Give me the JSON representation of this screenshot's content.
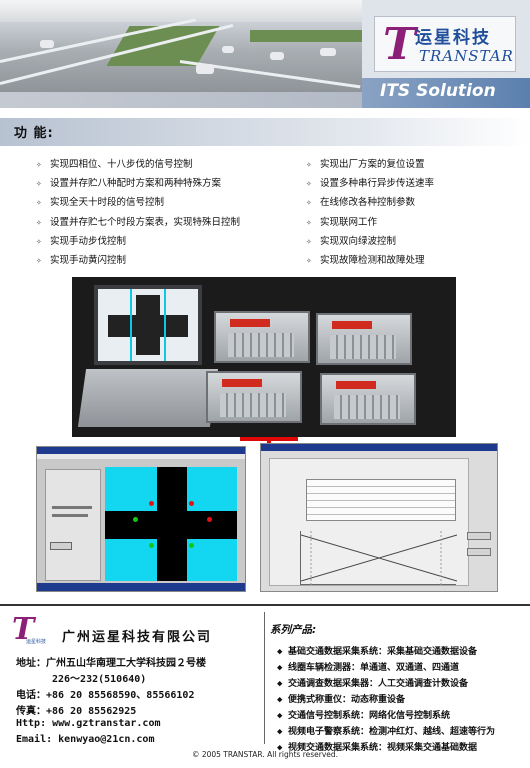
{
  "header": {
    "logo_icon": "T",
    "logo_cn": "运星科技",
    "logo_en": "TRANSTAR",
    "banner": "ITS Solution"
  },
  "features": {
    "title": "功  能:",
    "bullet": "✧",
    "left": [
      "实现四相位、十八步伐的信号控制",
      "设置并存贮八种配时方案和两种特殊方案",
      "实现全天十时段的信号控制",
      "设置并存贮七个时段方案表，实现特殊日控制",
      "实现手动步伐控制",
      "实现手动黄闪控制"
    ],
    "right": [
      "实现出厂方案的复位设置",
      "设置多种串行异步传送速率",
      "在线修改各种控制参数",
      "实现联网工作",
      "实现双向绿波控制",
      "实现故障检测和故障处理"
    ]
  },
  "company": {
    "logo_sub": "运星科技",
    "name": "广州运星科技有限公司",
    "address_1": "地址：广州五山华南理工大学科技园２号楼",
    "address_2": "226～232(510640)",
    "phone": "电话：+86 20 85568590、85566102",
    "fax": "传真：+86 20 85562925",
    "http": "Http: www.gztranstar.com",
    "email": "Email: kenwyao@21cn.com"
  },
  "products": {
    "title": "系列产品:",
    "bullet": "◆",
    "items": [
      "基础交通数据采集系统：采集基础交通数据设备",
      "线圈车辆检测器：单通道、双通道、四通道",
      "交通调查数据采集器：人工交通调查计数设备",
      "便携式称重仪：动态称重设备",
      "交通信号控制系统：网络化信号控制系统",
      "视频电子警察系统：检测冲红灯、越线、超速等行为",
      "视频交通数据采集系统：视频采集交通基础数据"
    ]
  },
  "copyright": "© 2005 TRANSTAR. All rights reserved."
}
